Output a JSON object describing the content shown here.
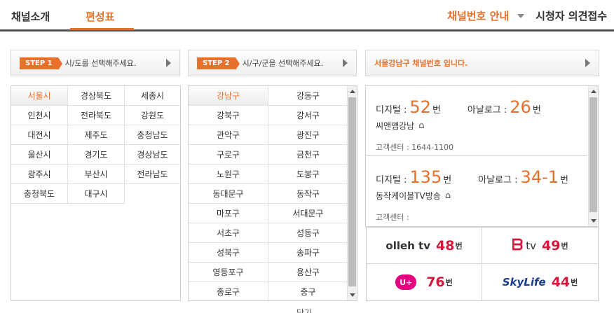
{
  "nav": {
    "tabs": [
      "채널소개",
      "편성표"
    ],
    "channel_guide": "채널번호 안내",
    "feedback": "시청자 의견접수"
  },
  "step1": {
    "badge": "STEP 1",
    "text": "시/도를 선택해주세요."
  },
  "step2": {
    "badge": "STEP 2",
    "text": "시/구/군을 선택해주세요."
  },
  "step3": {
    "text": "서울강남구 채널번호 입니다."
  },
  "regions": [
    "서울시",
    "경상북도",
    "세종시",
    "인천시",
    "전라북도",
    "강원도",
    "대전시",
    "제주도",
    "충청남도",
    "울산시",
    "경기도",
    "경상남도",
    "광주시",
    "부산시",
    "전라남도",
    "충청북도",
    "대구시"
  ],
  "districts": [
    "강남구",
    "강동구",
    "강북구",
    "강서구",
    "관악구",
    "광진구",
    "구로구",
    "금천구",
    "노원구",
    "도봉구",
    "동대문구",
    "동작구",
    "마포구",
    "서대문구",
    "서초구",
    "성동구",
    "성북구",
    "송파구",
    "영등포구",
    "용산구",
    "종로구",
    "중구"
  ],
  "providers": [
    {
      "digital_label": "디지털 :",
      "digital_num": "52",
      "unit": "번",
      "analog_label": "아날로그 :",
      "analog_num": "26",
      "name": "씨앤앰강남",
      "center": "고객센터 : 1644-1100"
    },
    {
      "digital_label": "디지털 :",
      "digital_num": "135",
      "unit": "번",
      "analog_label": "아날로그 :",
      "analog_num": "34-1",
      "name": "동작케이블TV방송",
      "center": "고객센터 :"
    }
  ],
  "iptv": [
    {
      "name": "olleh tv",
      "num": "48",
      "unit": "번"
    },
    {
      "name": "tv",
      "num": "49",
      "unit": "번"
    },
    {
      "name": "U+",
      "num": "76",
      "unit": "번"
    },
    {
      "name": "SkyLife",
      "num": "44",
      "unit": "번"
    }
  ],
  "close_label": "닫기"
}
